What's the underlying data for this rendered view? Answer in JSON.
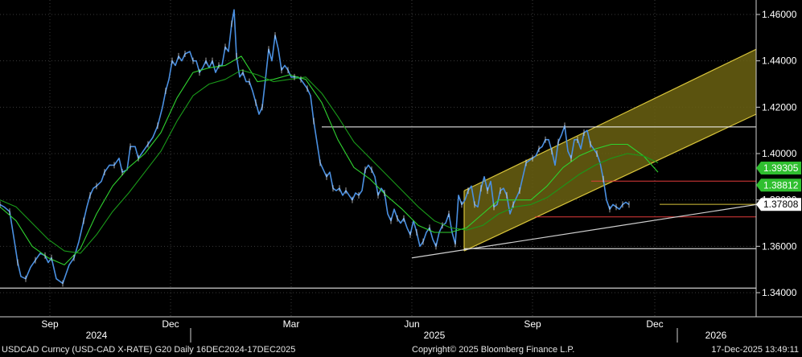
{
  "footer": {
    "left": "USDCAD Curncy (USD-CAD X-RATE) G20 Daily 16DEC2024-17DEC2025",
    "center": "Copyright© 2025 Bloomberg Finance L.P.",
    "right": "17-Dec-2025 13:49:11"
  },
  "colors": {
    "background": "#000000",
    "price": "#4a90e2",
    "ma_fast": "#2fd12f",
    "ma_slow": "#1a9a1a",
    "channel": "#d8c43a",
    "channel_fill": "#6b6212",
    "support": "#ffffff",
    "resistance_red": "#e23b3b",
    "label_green": "#2fbf2f",
    "label_last": "#ffffff"
  },
  "chart_data": {
    "type": "line",
    "y_ticks": [
      "1.34000",
      "1.36000",
      "1.38000",
      "1.40000",
      "1.42000",
      "1.44000",
      "1.46000"
    ],
    "ylim": [
      1.333,
      1.4665
    ],
    "x_month_labels": [
      "Sep",
      "Dec",
      "Mar",
      "Jun",
      "Sep",
      "Dec"
    ],
    "x_year_labels": [
      "2024",
      "2025",
      "2026"
    ],
    "price_labels": [
      "1.39305",
      "1.38812",
      "1.37808"
    ],
    "series": [
      {
        "role": "price",
        "t": [
          0,
          5,
          12,
          18,
          22,
          26,
          32,
          38,
          44,
          50,
          56,
          60,
          64,
          70,
          78,
          86,
          92,
          98,
          104,
          108,
          112,
          116,
          120,
          126,
          130,
          136,
          142,
          148,
          152,
          158,
          162,
          168,
          172,
          178,
          184,
          190,
          196,
          202,
          206,
          210,
          214,
          218,
          222,
          226,
          230,
          236,
          240,
          244,
          248,
          252,
          256,
          260,
          264,
          268,
          272,
          276,
          280,
          284,
          288,
          291,
          294,
          298,
          302,
          306,
          310,
          314,
          318,
          322,
          326,
          330,
          334,
          338,
          342,
          346,
          350,
          354,
          358,
          362,
          366,
          370,
          374,
          378,
          382,
          386,
          390,
          394,
          398,
          402,
          406,
          410,
          414,
          418,
          422,
          426,
          430,
          434,
          438,
          442,
          446,
          450,
          454,
          458,
          462,
          466,
          470,
          474,
          478,
          482,
          486,
          490,
          494,
          498,
          502,
          506,
          510,
          514,
          518,
          522,
          526,
          530,
          534,
          538,
          542,
          546,
          550,
          554,
          558,
          562,
          566,
          570,
          574,
          578,
          582,
          586,
          590,
          594,
          598,
          602,
          606,
          610,
          614,
          618,
          622,
          626,
          630,
          634,
          638,
          642,
          646,
          650,
          654,
          658,
          662,
          666,
          670,
          674,
          678,
          682,
          686,
          690,
          694,
          698,
          702,
          706,
          710,
          714,
          718,
          722,
          726,
          730,
          734,
          738,
          742,
          746,
          750,
          754,
          758,
          762,
          766,
          770,
          774,
          778,
          782,
          786,
          790,
          794,
          798,
          802,
          806,
          810,
          814,
          818
        ],
        "v": [
          1.378,
          1.377,
          1.375,
          1.362,
          1.353,
          1.347,
          1.346,
          1.351,
          1.354,
          1.357,
          1.356,
          1.353,
          1.355,
          1.346,
          1.344,
          1.352,
          1.355,
          1.362,
          1.371,
          1.377,
          1.382,
          1.385,
          1.386,
          1.388,
          1.392,
          1.395,
          1.395,
          1.398,
          1.392,
          1.393,
          1.403,
          1.403,
          1.398,
          1.401,
          1.404,
          1.407,
          1.412,
          1.42,
          1.427,
          1.432,
          1.44,
          1.438,
          1.442,
          1.44,
          1.443,
          1.444,
          1.44,
          1.44,
          1.435,
          1.437,
          1.44,
          1.437,
          1.44,
          1.435,
          1.438,
          1.438,
          1.446,
          1.444,
          1.456,
          1.462,
          1.442,
          1.433,
          1.435,
          1.431,
          1.431,
          1.427,
          1.422,
          1.417,
          1.42,
          1.432,
          1.445,
          1.44,
          1.451,
          1.445,
          1.436,
          1.438,
          1.436,
          1.433,
          1.433,
          1.433,
          1.432,
          1.43,
          1.428,
          1.425,
          1.414,
          1.405,
          1.396,
          1.393,
          1.39,
          1.392,
          1.385,
          1.384,
          1.385,
          1.382,
          1.384,
          1.382,
          1.38,
          1.383,
          1.382,
          1.384,
          1.393,
          1.395,
          1.393,
          1.39,
          1.382,
          1.385,
          1.383,
          1.374,
          1.371,
          1.376,
          1.372,
          1.37,
          1.372,
          1.368,
          1.365,
          1.371,
          1.366,
          1.36,
          1.362,
          1.366,
          1.368,
          1.363,
          1.36,
          1.366,
          1.369,
          1.37,
          1.374,
          1.366,
          1.361,
          1.382,
          1.378,
          1.38,
          1.384,
          1.386,
          1.378,
          1.377,
          1.385,
          1.39,
          1.384,
          1.388,
          1.377,
          1.378,
          1.384,
          1.385,
          1.382,
          1.374,
          1.378,
          1.381,
          1.384,
          1.39,
          1.396,
          1.397,
          1.398,
          1.399,
          1.402,
          1.403,
          1.406,
          1.406,
          1.401,
          1.395,
          1.405,
          1.408,
          1.412,
          1.401,
          1.398,
          1.406,
          1.406,
          1.402,
          1.409,
          1.41,
          1.404,
          1.402,
          1.4,
          1.396,
          1.389,
          1.38,
          1.376,
          1.378,
          1.377,
          1.376,
          1.378,
          1.379,
          1.378
        ]
      },
      {
        "role": "ma_fast",
        "t": [
          0,
          20,
          40,
          60,
          80,
          100,
          120,
          140,
          160,
          180,
          200,
          220,
          240,
          260,
          280,
          300,
          320,
          340,
          360,
          380,
          400,
          420,
          440,
          460,
          480,
          500,
          520,
          540,
          560,
          580,
          600,
          620,
          640,
          660,
          680,
          700,
          720,
          740,
          760,
          780,
          800,
          818
        ],
        "v": [
          1.377,
          1.371,
          1.36,
          1.355,
          1.352,
          1.359,
          1.374,
          1.386,
          1.394,
          1.4,
          1.409,
          1.424,
          1.435,
          1.437,
          1.438,
          1.442,
          1.431,
          1.432,
          1.434,
          1.432,
          1.422,
          1.406,
          1.394,
          1.389,
          1.382,
          1.376,
          1.369,
          1.366,
          1.366,
          1.368,
          1.374,
          1.38,
          1.38,
          1.38,
          1.386,
          1.394,
          1.399,
          1.402,
          1.404,
          1.404,
          1.399,
          1.392
        ]
      },
      {
        "role": "ma_slow",
        "t": [
          0,
          20,
          40,
          60,
          80,
          100,
          120,
          140,
          160,
          180,
          200,
          220,
          240,
          260,
          280,
          300,
          320,
          340,
          360,
          380,
          400,
          420,
          440,
          460,
          480,
          500,
          520,
          540,
          560,
          580,
          600,
          620,
          640,
          660,
          680,
          700,
          720,
          740,
          760,
          780,
          800,
          818
        ],
        "v": [
          1.38,
          1.377,
          1.37,
          1.363,
          1.358,
          1.357,
          1.365,
          1.375,
          1.383,
          1.392,
          1.401,
          1.414,
          1.425,
          1.43,
          1.432,
          1.436,
          1.434,
          1.431,
          1.432,
          1.433,
          1.426,
          1.416,
          1.405,
          1.398,
          1.391,
          1.384,
          1.377,
          1.371,
          1.368,
          1.367,
          1.369,
          1.374,
          1.377,
          1.378,
          1.381,
          1.386,
          1.391,
          1.395,
          1.398,
          1.4,
          1.399,
          1.396
        ]
      }
    ],
    "channel": {
      "lower_start": [
        577,
        1.358
      ],
      "lower_end": [
        940,
        1.417
      ],
      "upper_start": [
        577,
        1.384
      ],
      "upper_end": [
        940,
        1.445
      ]
    },
    "support_line": {
      "start": [
        512,
        1.355
      ],
      "end": [
        940,
        1.378
      ]
    },
    "horizontal_levels": [
      {
        "value": 1.4115,
        "from": 400,
        "to": 940,
        "color": "support"
      },
      {
        "value": 1.359,
        "from": 577,
        "to": 940,
        "color": "support"
      },
      {
        "value": 1.342,
        "from": 0,
        "to": 940,
        "color": "support"
      },
      {
        "value": 1.3881,
        "from": 735,
        "to": 940,
        "color": "resistance_red"
      },
      {
        "value": 1.3727,
        "from": 665,
        "to": 940,
        "color": "resistance_red"
      },
      {
        "value": 1.3781,
        "from": 820,
        "to": 940,
        "color": "channel"
      }
    ]
  }
}
